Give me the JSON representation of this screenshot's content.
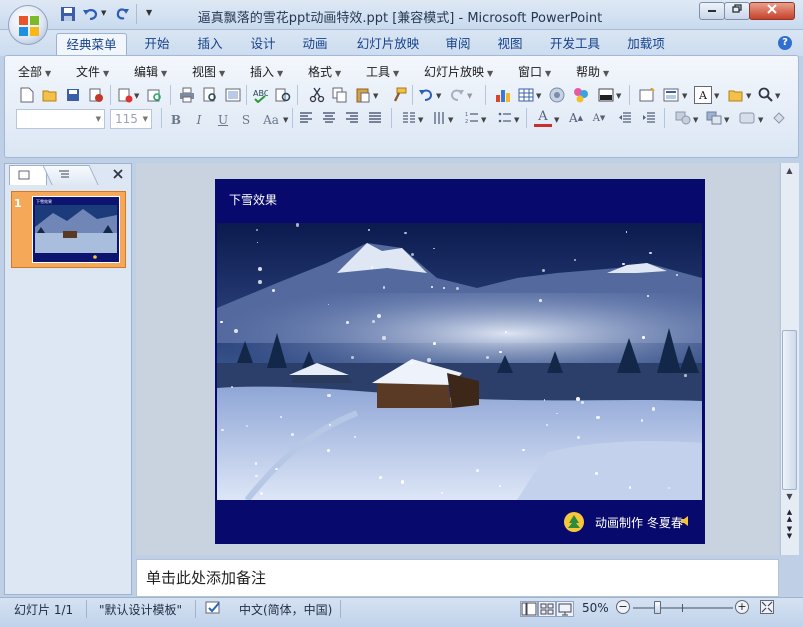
{
  "window": {
    "title": "逼真飘落的雪花ppt动画特效.ppt [兼容模式] - Microsoft PowerPoint",
    "controls": [
      "minimize",
      "restore",
      "close"
    ]
  },
  "quick_access": {
    "icons": [
      "save-icon",
      "undo-icon",
      "redo-icon",
      "customize-dropdown-icon"
    ]
  },
  "tabs": [
    {
      "label": "经典菜单",
      "active": true
    },
    {
      "label": "开始"
    },
    {
      "label": "插入"
    },
    {
      "label": "设计"
    },
    {
      "label": "动画"
    },
    {
      "label": "幻灯片放映"
    },
    {
      "label": "审阅"
    },
    {
      "label": "视图"
    },
    {
      "label": "开发工具"
    },
    {
      "label": "加载项"
    }
  ],
  "classic_menu": [
    "全部",
    "文件",
    "编辑",
    "视图",
    "插入",
    "格式",
    "工具",
    "幻灯片放映",
    "窗口",
    "帮助"
  ],
  "font_size": "115",
  "format_buttons": [
    "B",
    "I",
    "U",
    "S",
    "Aa"
  ],
  "left_pane": {
    "slide_number": "1"
  },
  "slide": {
    "title": "下雪效果",
    "credit": "动画制作 冬夏春"
  },
  "notes": {
    "placeholder": "单击此处添加备注"
  },
  "status": {
    "slide_count": "幻灯片 1/1",
    "template": "\"默认设计模板\"",
    "language": "中文(简体，中国)",
    "zoom": "50%"
  },
  "colors": {
    "slide_background": "#070a6c",
    "thumbnail_selected": "#f5a857",
    "ribbon_text": "#15428b"
  }
}
